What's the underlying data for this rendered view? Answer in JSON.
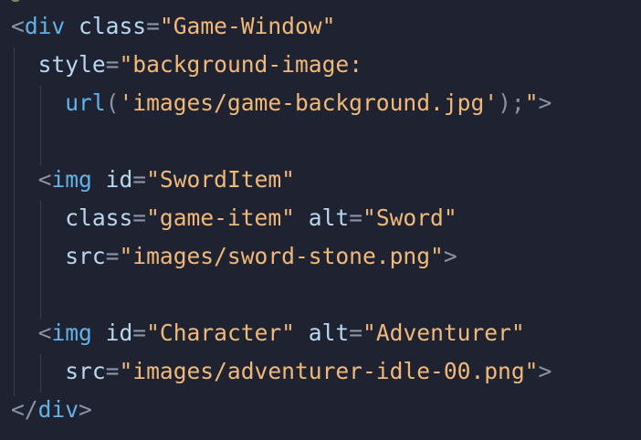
{
  "code": {
    "lines": [
      {
        "indent": "",
        "tokens": [
          {
            "t": "<",
            "c": "p"
          },
          {
            "t": "div",
            "c": "t"
          },
          {
            "t": " ",
            "c": "x"
          },
          {
            "t": "class",
            "c": "a"
          },
          {
            "t": "=",
            "c": "p"
          },
          {
            "t": "\"Game-Window\"",
            "c": "s"
          }
        ]
      },
      {
        "indent": "  ",
        "tokens": [
          {
            "t": "style",
            "c": "a"
          },
          {
            "t": "=",
            "c": "p"
          },
          {
            "t": "\"background-image:",
            "c": "s"
          }
        ]
      },
      {
        "indent": "    ",
        "tokens": [
          {
            "t": "url",
            "c": "f"
          },
          {
            "t": "(",
            "c": "p"
          },
          {
            "t": "'images/game-background.jpg'",
            "c": "s"
          },
          {
            "t": ");",
            "c": "p"
          },
          {
            "t": "\"",
            "c": "s"
          },
          {
            "t": ">",
            "c": "p"
          }
        ]
      },
      {
        "indent": "",
        "tokens": []
      },
      {
        "indent": "  ",
        "tokens": [
          {
            "t": "<",
            "c": "p"
          },
          {
            "t": "img",
            "c": "t"
          },
          {
            "t": " ",
            "c": "x"
          },
          {
            "t": "id",
            "c": "a"
          },
          {
            "t": "=",
            "c": "p"
          },
          {
            "t": "\"SwordItem\"",
            "c": "s"
          }
        ]
      },
      {
        "indent": "    ",
        "tokens": [
          {
            "t": "class",
            "c": "a"
          },
          {
            "t": "=",
            "c": "p"
          },
          {
            "t": "\"game-item\"",
            "c": "s"
          },
          {
            "t": " ",
            "c": "x"
          },
          {
            "t": "alt",
            "c": "a"
          },
          {
            "t": "=",
            "c": "p"
          },
          {
            "t": "\"Sword\"",
            "c": "s"
          }
        ]
      },
      {
        "indent": "    ",
        "tokens": [
          {
            "t": "src",
            "c": "a"
          },
          {
            "t": "=",
            "c": "p"
          },
          {
            "t": "\"images/sword-stone.png\"",
            "c": "s"
          },
          {
            "t": ">",
            "c": "p"
          }
        ]
      },
      {
        "indent": "",
        "tokens": []
      },
      {
        "indent": "  ",
        "tokens": [
          {
            "t": "<",
            "c": "p"
          },
          {
            "t": "img",
            "c": "t"
          },
          {
            "t": " ",
            "c": "x"
          },
          {
            "t": "id",
            "c": "a"
          },
          {
            "t": "=",
            "c": "p"
          },
          {
            "t": "\"Character\"",
            "c": "s"
          },
          {
            "t": " ",
            "c": "x"
          },
          {
            "t": "alt",
            "c": "a"
          },
          {
            "t": "=",
            "c": "p"
          },
          {
            "t": "\"Adventurer\"",
            "c": "s"
          }
        ]
      },
      {
        "indent": "    ",
        "tokens": [
          {
            "t": "src",
            "c": "a"
          },
          {
            "t": "=",
            "c": "p"
          },
          {
            "t": "\"images/adventurer-idle-00.png\"",
            "c": "s"
          },
          {
            "t": ">",
            "c": "p"
          }
        ]
      },
      {
        "indent": "",
        "tokens": [
          {
            "t": "</",
            "c": "p"
          },
          {
            "t": "div",
            "c": "t"
          },
          {
            "t": ">",
            "c": "p"
          }
        ]
      }
    ]
  },
  "colors": {
    "background": "#1f2331",
    "tag": "#62b1e8",
    "attribute": "#b9d7f0",
    "string": "#f0b97a",
    "punctuation": "#8b93a6",
    "indent_guide": "#3a3f50"
  }
}
